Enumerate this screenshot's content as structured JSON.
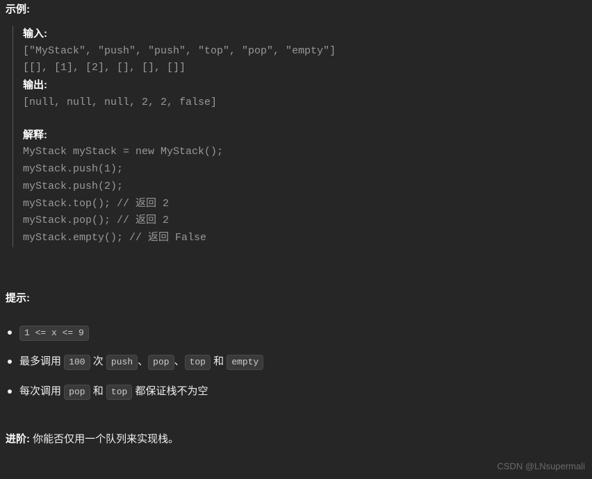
{
  "example": {
    "title": "示例:",
    "input_label": "输入:",
    "input_line1": "[\"MyStack\", \"push\", \"push\", \"top\", \"pop\", \"empty\"]",
    "input_line2": "[[], [1], [2], [], [], []]",
    "output_label": "输出:",
    "output_line": "[null, null, null, 2, 2, false]",
    "explain_label": "解释:",
    "code_lines": [
      "MyStack myStack = new MyStack();",
      "myStack.push(1);",
      "myStack.push(2);",
      "myStack.top(); // 返回 2",
      "myStack.pop(); // 返回 2",
      "myStack.empty(); // 返回 False"
    ]
  },
  "hints": {
    "title": "提示:",
    "item1_chip": "1 <= x <= 9",
    "item2_prefix": "最多调用 ",
    "item2_chip1": "100",
    "item2_mid1": " 次 ",
    "item2_chip2": "push",
    "item2_sep1": "、",
    "item2_chip3": "pop",
    "item2_sep2": "、",
    "item2_chip4": "top",
    "item2_mid2": " 和 ",
    "item2_chip5": "empty",
    "item3_prefix": "每次调用 ",
    "item3_chip1": "pop",
    "item3_mid": " 和 ",
    "item3_chip2": "top",
    "item3_suffix": " 都保证栈不为空"
  },
  "advanced": {
    "label": "进阶:",
    "text": " 你能否仅用一个队列来实现栈。"
  },
  "watermark": "CSDN @LNsupermali"
}
